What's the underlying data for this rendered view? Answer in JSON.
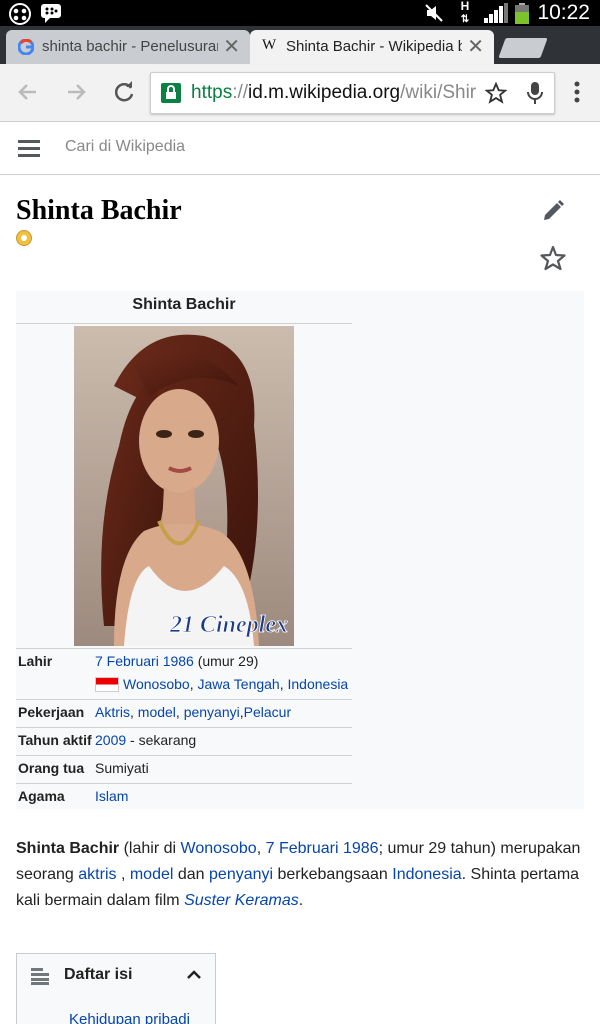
{
  "status_bar": {
    "time": "10:22",
    "network_label": "H",
    "icons": [
      "blackberry-icon",
      "bbm-chat-icon",
      "mute-icon",
      "network-h-icon",
      "signal-icon",
      "battery-icon"
    ]
  },
  "browser": {
    "tabs": [
      {
        "title": "shinta bachir - Penelusuran",
        "favicon": "google-favicon",
        "active": false
      },
      {
        "title": "Shinta Bachir - Wikipedia ba",
        "favicon": "wikipedia-favicon",
        "favicon_text": "W",
        "active": true
      }
    ],
    "close_glyph": "✕",
    "url": {
      "scheme": "https",
      "separator": "://",
      "host": "id.m.wikipedia.org",
      "path": "/wiki/Shir"
    }
  },
  "wiki": {
    "search_placeholder": "Cari di Wikipedia",
    "page_title": "Shinta Bachir"
  },
  "infobox": {
    "title": "Shinta Bachir",
    "photo_watermark": "21 Cineplex",
    "rows": {
      "lahir": {
        "label": "Lahir",
        "date_link": "7 Februari 1986",
        "age": "(umur 29)",
        "place_1": "Wonosobo",
        "place_2": "Jawa Tengah",
        "place_3": "Indonesia",
        "comma": ","
      },
      "pekerjaan": {
        "label": "Pekerjaan",
        "items": [
          "Aktris",
          "model",
          "penyanyi",
          "Pelacur"
        ]
      },
      "tahun_aktif": {
        "label": "Tahun aktif",
        "year_link": "2009",
        "suffix": " - sekarang"
      },
      "orang_tua": {
        "label": "Orang tua",
        "value": "Sumiyati"
      },
      "agama": {
        "label": "Agama",
        "value": "Islam"
      }
    }
  },
  "paragraph": {
    "bold_name": "Shinta Bachir",
    "t1": " (lahir di ",
    "link_wonosobo": "Wonosobo",
    "t2": ", ",
    "link_date": "7 Februari 1986",
    "t3": "; umur 29 tahun) merupakan seorang ",
    "link_aktris": "aktris",
    "t4": " , ",
    "link_model": "model",
    "t5": " dan ",
    "link_penyanyi": "penyanyi",
    "t6": " berkebangsaan ",
    "link_indonesia": "Indonesia",
    "t7": ". Shinta pertama kali bermain dalam film ",
    "link_film": "Suster Keramas",
    "t8": "."
  },
  "toc": {
    "title": "Daftar isi",
    "first_item": "Kehidupan pribadi"
  },
  "colors": {
    "link": "#0645ad",
    "tab_bar": "#2f3236",
    "secure_green": "#0b8043",
    "infobox_bg": "#f8f9fa"
  }
}
